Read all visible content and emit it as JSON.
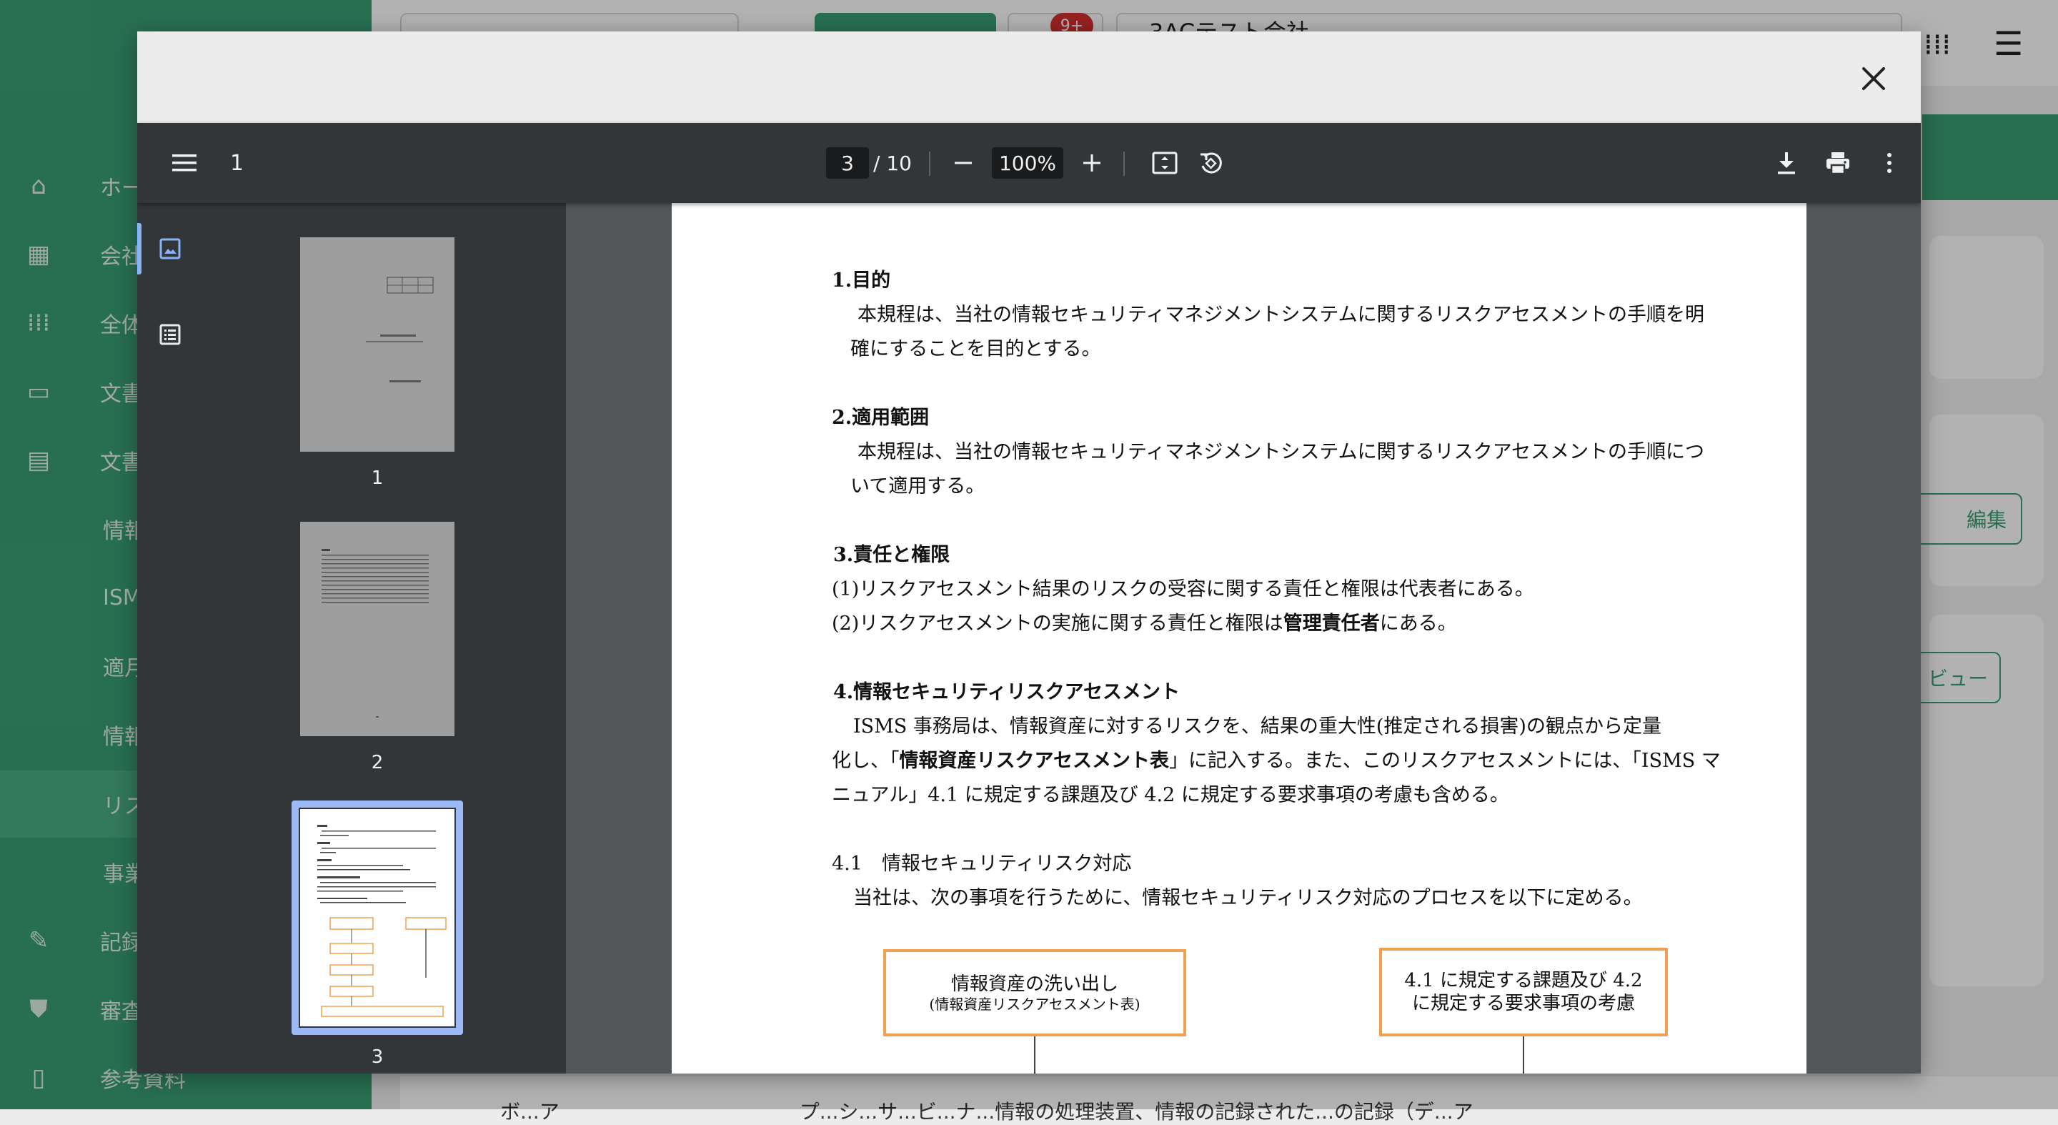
{
  "background": {
    "sidebar_items": [
      {
        "icon": "home-icon",
        "label": "ホー"
      },
      {
        "icon": "building-icon",
        "label": "会社"
      },
      {
        "icon": "apps-icon",
        "label": "全体"
      },
      {
        "icon": "folder-icon",
        "label": "文書"
      },
      {
        "icon": "document-icon",
        "label": "文書"
      },
      {
        "icon": "",
        "label": "情報"
      },
      {
        "icon": "",
        "label": "ISM"
      },
      {
        "icon": "",
        "label": "適月"
      },
      {
        "icon": "",
        "label": "情報"
      },
      {
        "icon": "",
        "label": "リス"
      },
      {
        "icon": "",
        "label": "事業"
      },
      {
        "icon": "pencil-icon",
        "label": "記録"
      },
      {
        "icon": "shield-check-icon",
        "label": "審査"
      },
      {
        "icon": "book-icon",
        "label": "参考資料"
      }
    ],
    "topbar": {
      "badge": "9+",
      "company": "3ACテスト会社"
    },
    "edit_button": "編集",
    "view_button": "ビュー",
    "bottom_text": "ボ...ア　　　　　　　　　　　　プ...シ...サ...ビ...ナ...情報の処理装置、情報の記録された...の記録（デ...ア"
  },
  "viewer": {
    "title": "1",
    "current_page": "3",
    "total_pages": "/ 10",
    "zoom": "100%"
  },
  "thumbnails": [
    {
      "label": "1"
    },
    {
      "label": "2"
    },
    {
      "label": "3"
    }
  ],
  "document": {
    "sec1_heading": "1.目的",
    "sec1_line1": "本規程は、当社の情報セキュリティマネジメントシステムに関するリスクアセスメントの手順を明",
    "sec1_line2": "確にすることを目的とする。",
    "sec2_heading": "2.適用範囲",
    "sec2_line1": "本規程は、当社の情報セキュリティマネジメントシステムに関するリスクアセスメントの手順につ",
    "sec2_line2": "いて適用する。",
    "sec3_heading": "3.責任と権限",
    "sec3_line1": "(1)リスクアセスメント結果のリスクの受容に関する責任と権限は代表者にある。",
    "sec3_line2_pre": "(2)リスクアセスメントの実施に関する責任と権限は",
    "sec3_line2_bold": "管理責任者",
    "sec3_line2_post": "にある。",
    "sec4_heading": "4.情報セキュリティリスクアセスメント",
    "sec4_line1": "ISMS 事務局は、情報資産に対するリスクを、結果の重大性(推定される損害)の観点から定量",
    "sec4_line2_pre": "化し、「",
    "sec4_line2_bold": "情報資産リスクアセスメント表",
    "sec4_line2_post": "」に記入する。また、このリスクアセスメントには、「ISMS マ",
    "sec4_line3": "ニュアル」4.1 に規定する課題及び 4.2 に規定する要求事項の考慮も含める。",
    "sec41_heading": "4.1　情報セキュリティリスク対応",
    "sec41_line1": "当社は、次の事項を行うために、情報セキュリティリスク対応のプロセスを以下に定める。",
    "box1_title": "情報資産の洗い出し",
    "box1_sub": "(情報資産リスクアセスメント表)",
    "box2_line1": "4.1 に規定する課題及び 4.2",
    "box2_line2": "に規定する要求事項の考慮"
  },
  "colors": {
    "sidebar_green": "#3aa076",
    "viewer_toolbar": "#323639",
    "viewer_bg": "#525659",
    "flow_border": "#f0a050",
    "thumb_selected": "#9cbbf6"
  }
}
